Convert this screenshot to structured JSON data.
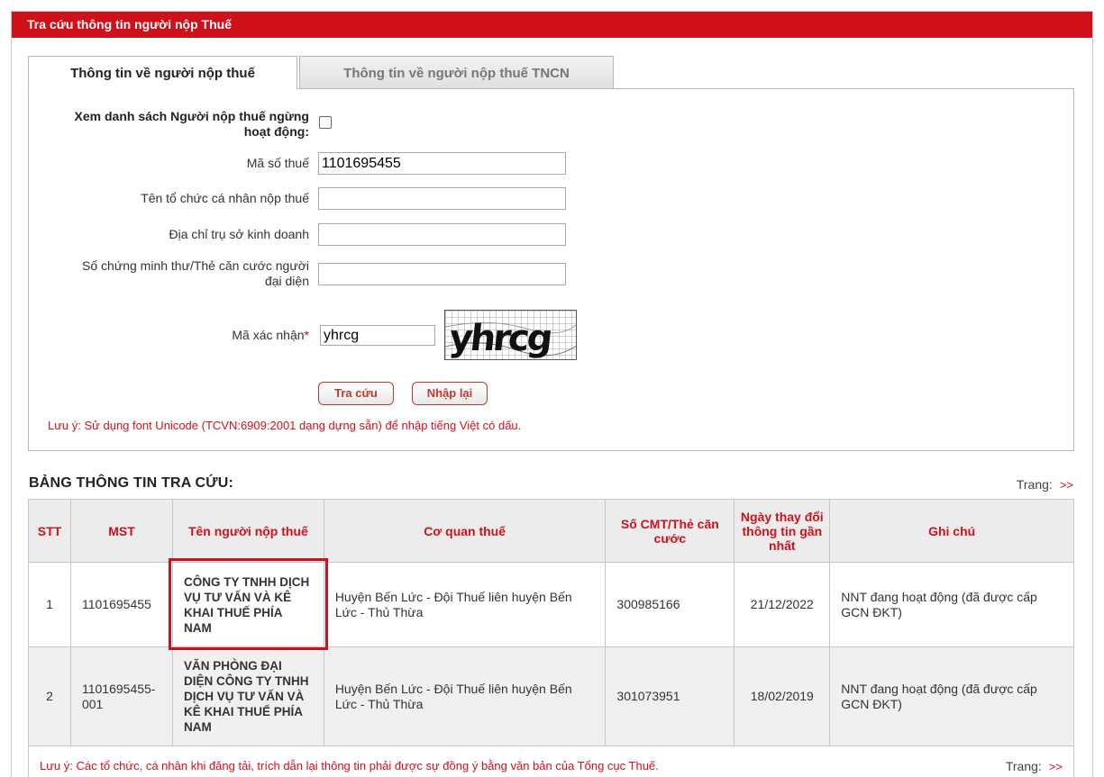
{
  "header": {
    "title": "Tra cứu thông tin người nộp Thuế"
  },
  "tabs": [
    {
      "label": "Thông tin về người nộp thuế",
      "active": true
    },
    {
      "label": "Thông tin về người nộp thuế TNCN",
      "active": false
    }
  ],
  "form": {
    "inactive_label_line1": "Xem danh sách Người nộp thuế ngừng",
    "inactive_label_line2": "hoạt động:",
    "tax_code_label": "Mã số thuế",
    "tax_code_value": "1101695455",
    "org_name_label": "Tên tổ chức cá nhân nộp thuế",
    "org_name_value": "",
    "address_label": "Địa chỉ trụ sở kinh doanh",
    "address_value": "",
    "id_label_line1": "Số chứng minh thư/Thẻ căn cước người",
    "id_label_line2": "đại diện",
    "id_value": "",
    "captcha_label": "Mã xác nhận",
    "captcha_required": "*",
    "captcha_value": "yhrcg",
    "captcha_image_text": "yhrcg",
    "search_button": "Tra cứu",
    "reset_button": "Nhập lại",
    "note": "Lưu ý: Sử dụng font Unicode (TCVN:6909:2001 dạng dựng sẵn) để nhập tiếng Việt có dấu."
  },
  "results": {
    "title": "BẢNG THÔNG TIN TRA CỨU:",
    "pager_label": "Trang:",
    "pager_next": ">>",
    "columns": {
      "stt": "STT",
      "mst": "MST",
      "name": "Tên người nộp thuế",
      "agency": "Cơ quan thuế",
      "id_no": "Số CMT/Thẻ căn cước",
      "updated": "Ngày thay đổi thông tin gần nhất",
      "note": "Ghi chú"
    },
    "rows": [
      {
        "stt": "1",
        "mst": "1101695455",
        "name": "CÔNG TY TNHH DỊCH VỤ TƯ VẤN VÀ KÊ KHAI THUẾ PHÍA NAM",
        "agency": "Huyện Bến Lức - Đội Thuế liên huyện Bến Lức - Thủ Thừa",
        "id_no": "300985166",
        "updated": "21/12/2022",
        "note": "NNT đang hoạt động (đã được cấp GCN ĐKT)"
      },
      {
        "stt": "2",
        "mst": "1101695455-001",
        "name": "VĂN PHÒNG ĐẠI DIỆN CÔNG TY TNHH DỊCH VỤ TƯ VẤN VÀ KÊ KHAI THUẾ PHÍA NAM",
        "agency": "Huyện Bến Lức - Đội Thuế liên huyện Bến Lức - Thủ Thừa",
        "id_no": "301073951",
        "updated": "18/02/2019",
        "note": "NNT đang hoạt động (đã được cấp GCN ĐKT)"
      }
    ],
    "footer_note": "Lưu ý: Các tổ chức, cá nhân khi đăng tải, trích dẫn lại thông tin phải được sự đồng ý bằng văn bản của Tổng cục Thuế."
  },
  "colors": {
    "accent": "#d0111b",
    "header_bg": "#ececec"
  }
}
